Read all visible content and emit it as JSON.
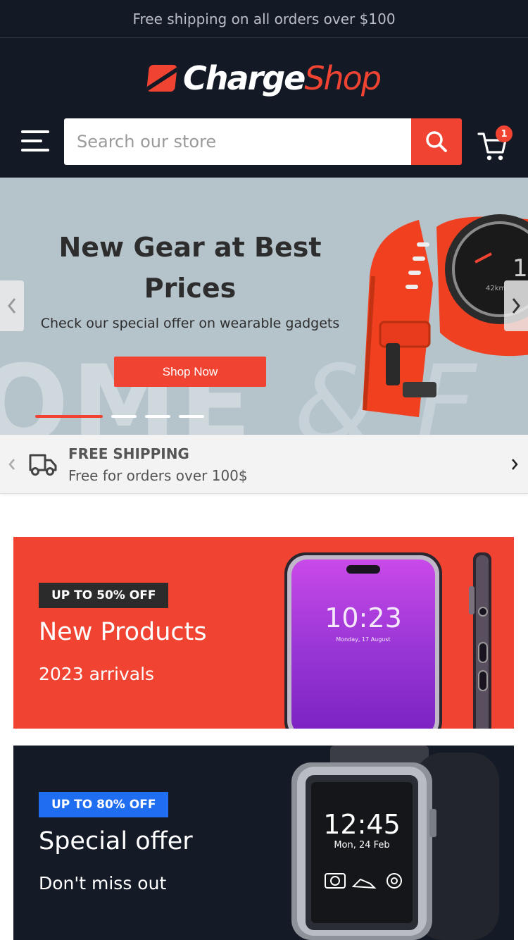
{
  "announcement": "Free shipping on all orders over $100",
  "logo": {
    "part1": "Charge",
    "part2": "Shop"
  },
  "search": {
    "placeholder": "Search our store"
  },
  "cart": {
    "count": "1"
  },
  "hero": {
    "title": "New Gear at Best Prices",
    "subtitle": "Check our special offer on wearable gadgets",
    "button": "Shop Now",
    "background_text": "OME",
    "background_text_2": "& F",
    "active_slide": 1,
    "slide_count": 4
  },
  "shipping": {
    "title": "FREE SHIPPING",
    "description": "Free for orders over 100$"
  },
  "promos": [
    {
      "tag": "UP TO 50% OFF",
      "title": "New Products",
      "subtitle": "2023 arrivals",
      "phone_time": "10:23",
      "phone_date": "Monday, 17 August"
    },
    {
      "tag": "UP TO 80% OFF",
      "title": "Special offer",
      "subtitle": "Don't miss out",
      "watch_time": "12:45",
      "watch_date": "Mon, 24 Feb"
    }
  ],
  "colors": {
    "brand_red": "#f04332",
    "dark_navy": "#131a26",
    "blue_tag": "#1f6ef1"
  },
  "icons": [
    "menu-icon",
    "search-icon",
    "cart-icon",
    "chevron-left-icon",
    "chevron-right-icon",
    "truck-icon"
  ]
}
